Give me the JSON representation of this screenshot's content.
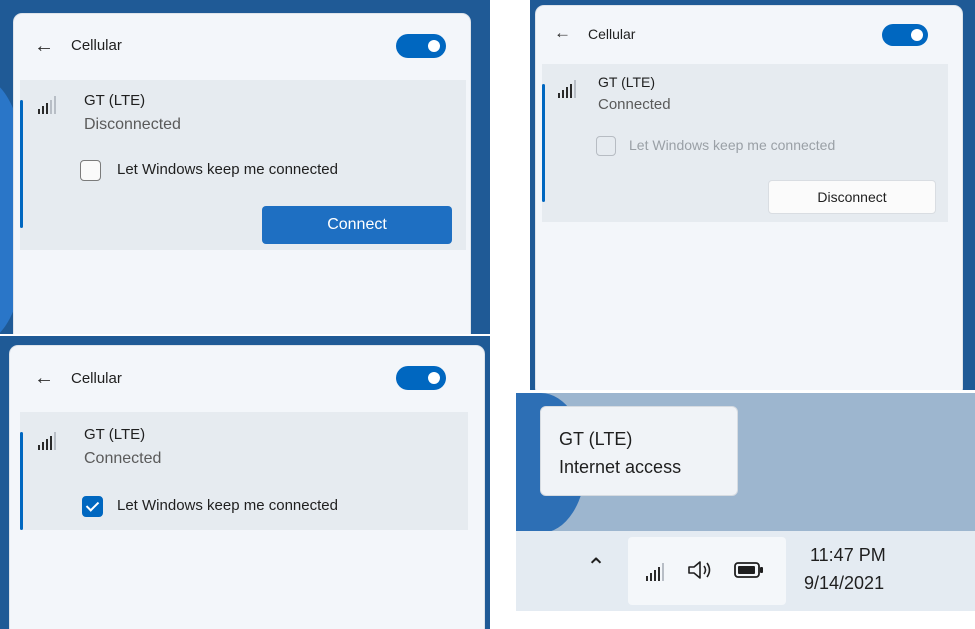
{
  "panels": [
    {
      "title": "Cellular",
      "network": "GT  (LTE)",
      "status": "Disconnected",
      "checkbox_label": "Let Windows keep me connected",
      "checkbox_checked": false,
      "button": "Connect"
    },
    {
      "title": "Cellular",
      "network": "GT  (LTE)",
      "status": "Connected",
      "checkbox_label": "Let Windows keep me connected",
      "checkbox_checked": false,
      "button": "Disconnect"
    },
    {
      "title": "Cellular",
      "network": "GT  (LTE)",
      "status": "Connected",
      "checkbox_label": "Let Windows keep me connected",
      "checkbox_checked": true
    }
  ],
  "tooltip": {
    "line1": "GT  (LTE)",
    "line2": "Internet access"
  },
  "taskbar": {
    "time": "11:47 PM",
    "date": "9/14/2021"
  },
  "icons": {
    "back": "arrow-left-icon",
    "signal": "cellular-signal-icon",
    "chevron": "chevron-up-icon",
    "volume": "speaker-icon",
    "battery": "battery-icon"
  },
  "colors": {
    "accent": "#0067c0",
    "flyout_bg": "#f3f6fa",
    "card_bg": "#e6ebf0"
  }
}
